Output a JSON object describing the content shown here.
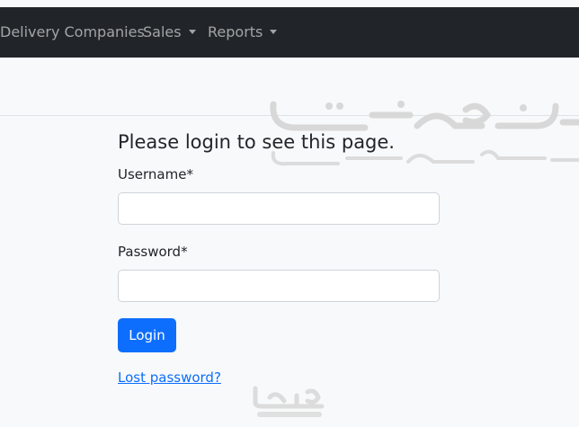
{
  "navbar": {
    "items": [
      {
        "label": "Delivery Companies",
        "dropdown": false
      },
      {
        "label": "Sales",
        "dropdown": true
      },
      {
        "label": "Reports",
        "dropdown": true
      }
    ]
  },
  "login": {
    "title": "Please login to see this page.",
    "username_label": "Username*",
    "username_value": "",
    "password_label": "Password*",
    "password_value": "",
    "button_label": "Login",
    "lost_password_label": "Lost password?"
  },
  "colors": {
    "navbar_bg": "#212529",
    "primary": "#0d6efd",
    "page_bg": "#f8f9fa"
  }
}
